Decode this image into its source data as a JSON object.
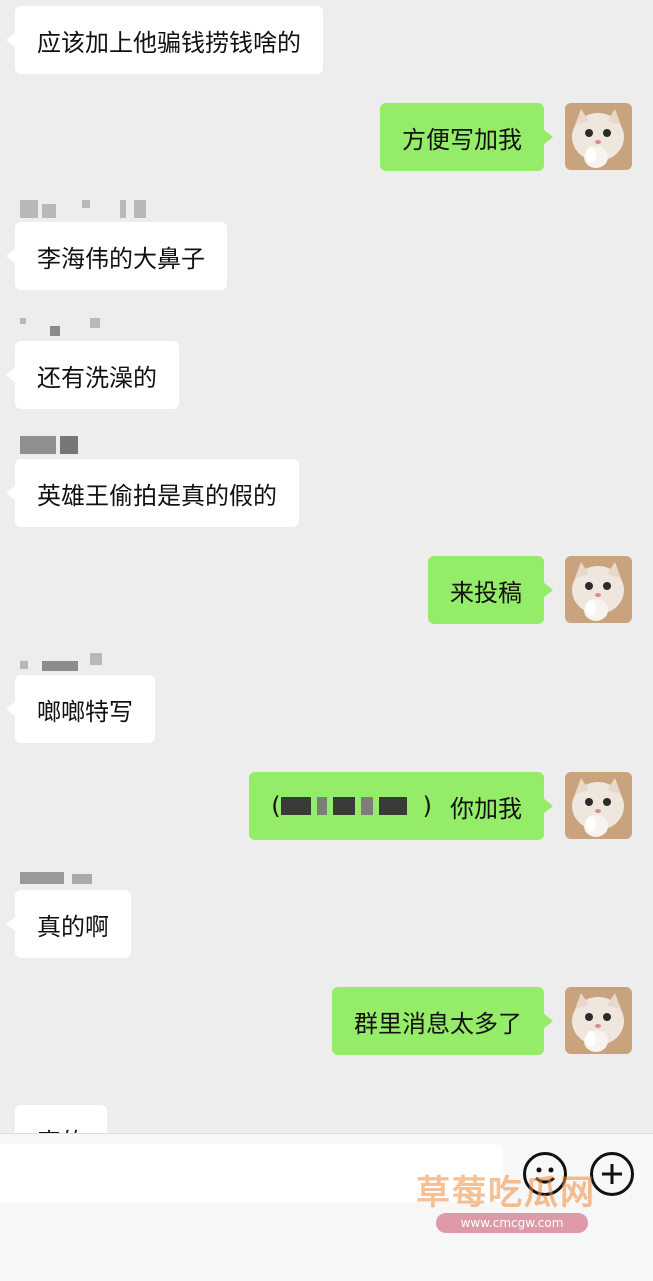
{
  "colors": {
    "background": "#ededed",
    "incoming_bubble": "#ffffff",
    "outgoing_bubble": "#95ec69"
  },
  "messages": [
    {
      "direction": "in",
      "text": "应该加上他骗钱捞钱啥的"
    },
    {
      "direction": "out",
      "text": "方便写加我"
    },
    {
      "direction": "in",
      "text": "李海伟的大鼻子"
    },
    {
      "direction": "in",
      "text": "还有洗澡的"
    },
    {
      "direction": "in",
      "text": "英雄王偷拍是真的假的"
    },
    {
      "direction": "out",
      "text": "来投稿"
    },
    {
      "direction": "in",
      "text": "啷啷特写"
    },
    {
      "direction": "out",
      "prefix": "(",
      "suffix": ")",
      "text": "你加我"
    },
    {
      "direction": "in",
      "text": "真的啊"
    },
    {
      "direction": "out",
      "text": "群里消息太多了"
    },
    {
      "direction": "in",
      "text": "真的"
    }
  ],
  "avatar": {
    "icon": "cat-avatar-icon"
  },
  "input_bar": {
    "emoji_icon": "emoji-icon",
    "add_icon": "plus-icon"
  },
  "watermark": {
    "main": "草莓吃瓜网",
    "sub": "www.cmcgw.com"
  }
}
